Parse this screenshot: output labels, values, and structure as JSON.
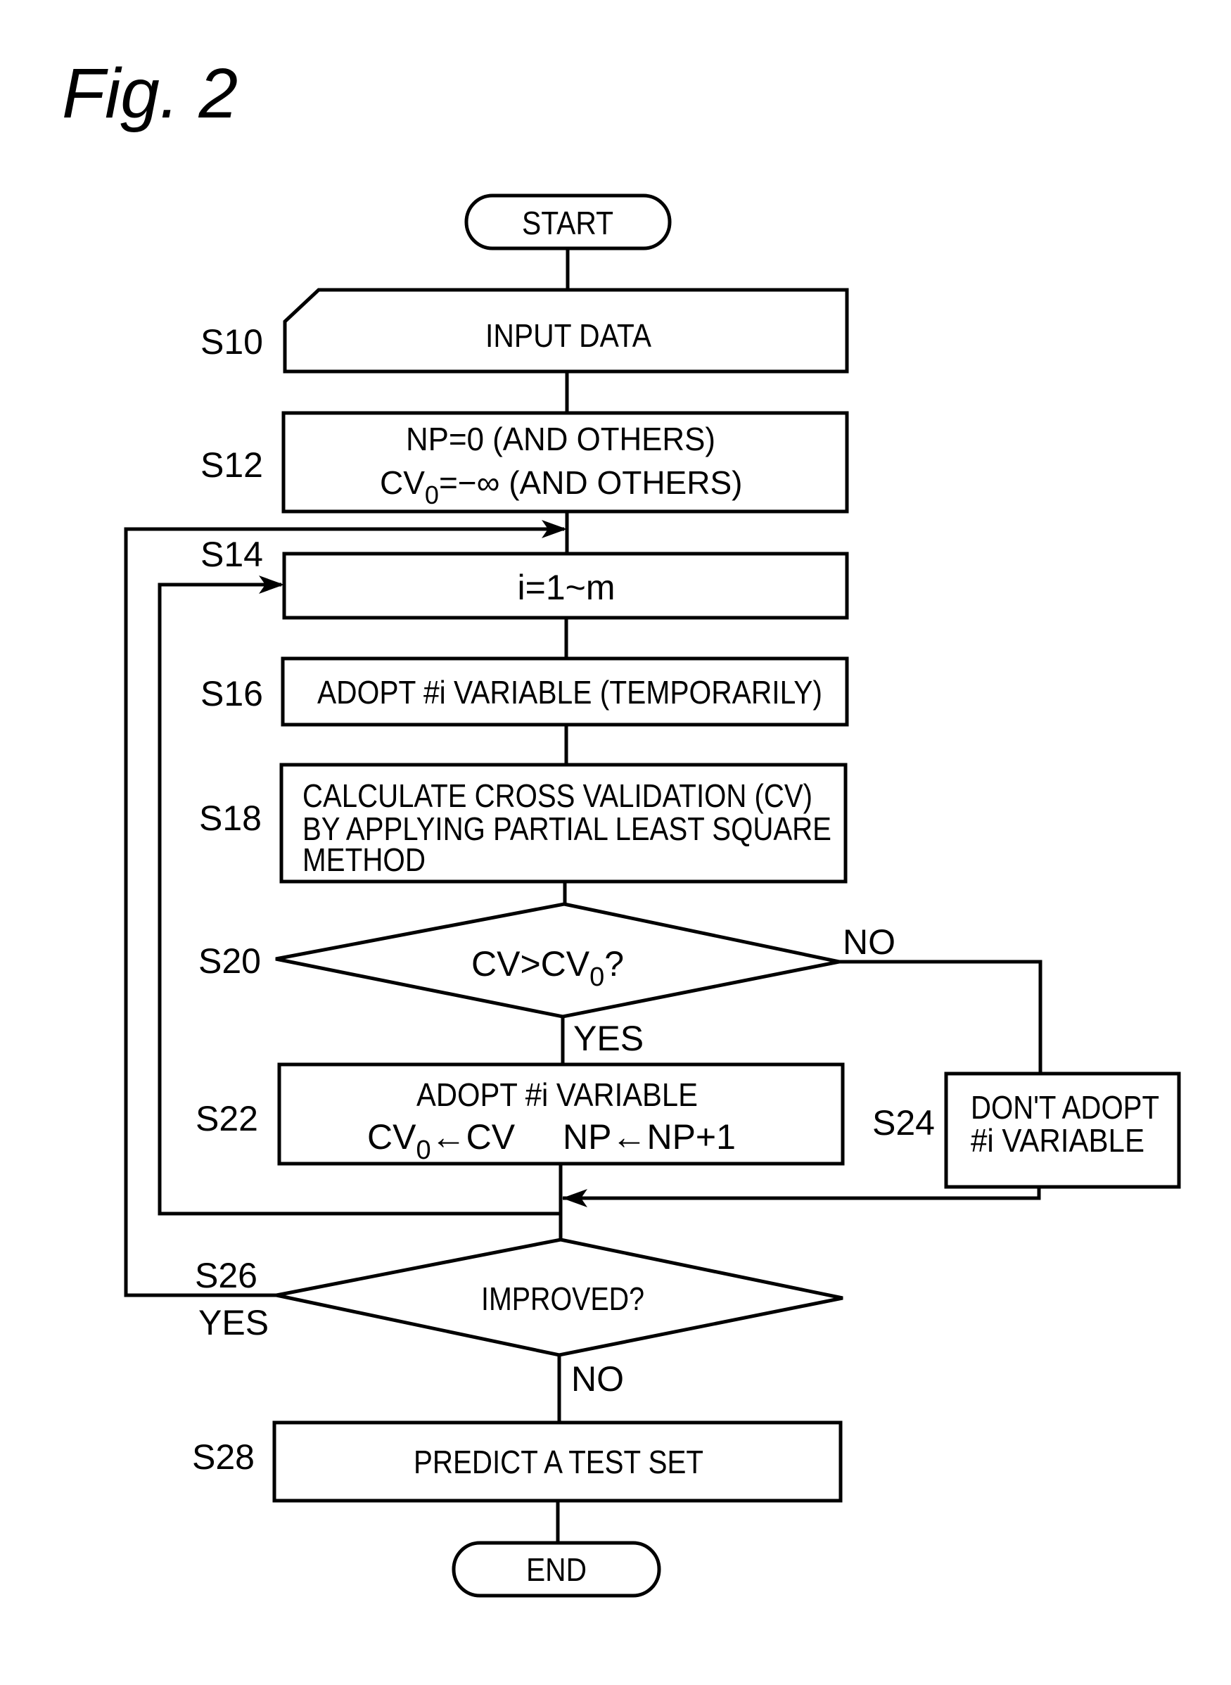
{
  "figure": {
    "title": "Fig. 2"
  },
  "colors": {
    "ink": "#000000",
    "paper": "#ffffff"
  },
  "flowchart": {
    "start": "START",
    "end": "END",
    "steps": {
      "s10": {
        "label": "S10",
        "lines": [
          "INPUT DATA"
        ]
      },
      "s12": {
        "label": "S12",
        "lines": [
          "NP=0 (AND OTHERS)",
          "CV",
          "0",
          "=−∞ (AND OTHERS)"
        ]
      },
      "s14": {
        "label": "S14",
        "lines": [
          "i=1~m"
        ]
      },
      "s16": {
        "label": "S16",
        "lines": [
          "ADOPT #i VARIABLE (TEMPORARILY)"
        ]
      },
      "s18": {
        "label": "S18",
        "lines": [
          "CALCULATE CROSS VALIDATION (CV)",
          "BY APPLYING PARTIAL LEAST SQUARE",
          "METHOD"
        ]
      },
      "s20": {
        "label": "S20",
        "cond_main": "CV>CV",
        "cond_sub": "0",
        "cond_tail": "?",
        "yes": "YES",
        "no": "NO"
      },
      "s22": {
        "label": "S22",
        "line1": "ADOPT #i VARIABLE",
        "cv": "CV",
        "cv_sub": "0",
        "cv_tail": "←CV",
        "np": "NP←NP+1"
      },
      "s24": {
        "label": "S24",
        "lines": [
          "DON'T ADOPT",
          "#i VARIABLE"
        ]
      },
      "s26": {
        "label": "S26",
        "cond": "IMPROVED?",
        "yes": "YES",
        "no": "NO"
      },
      "s28": {
        "label": "S28",
        "lines": [
          "PREDICT A TEST SET"
        ]
      }
    }
  }
}
